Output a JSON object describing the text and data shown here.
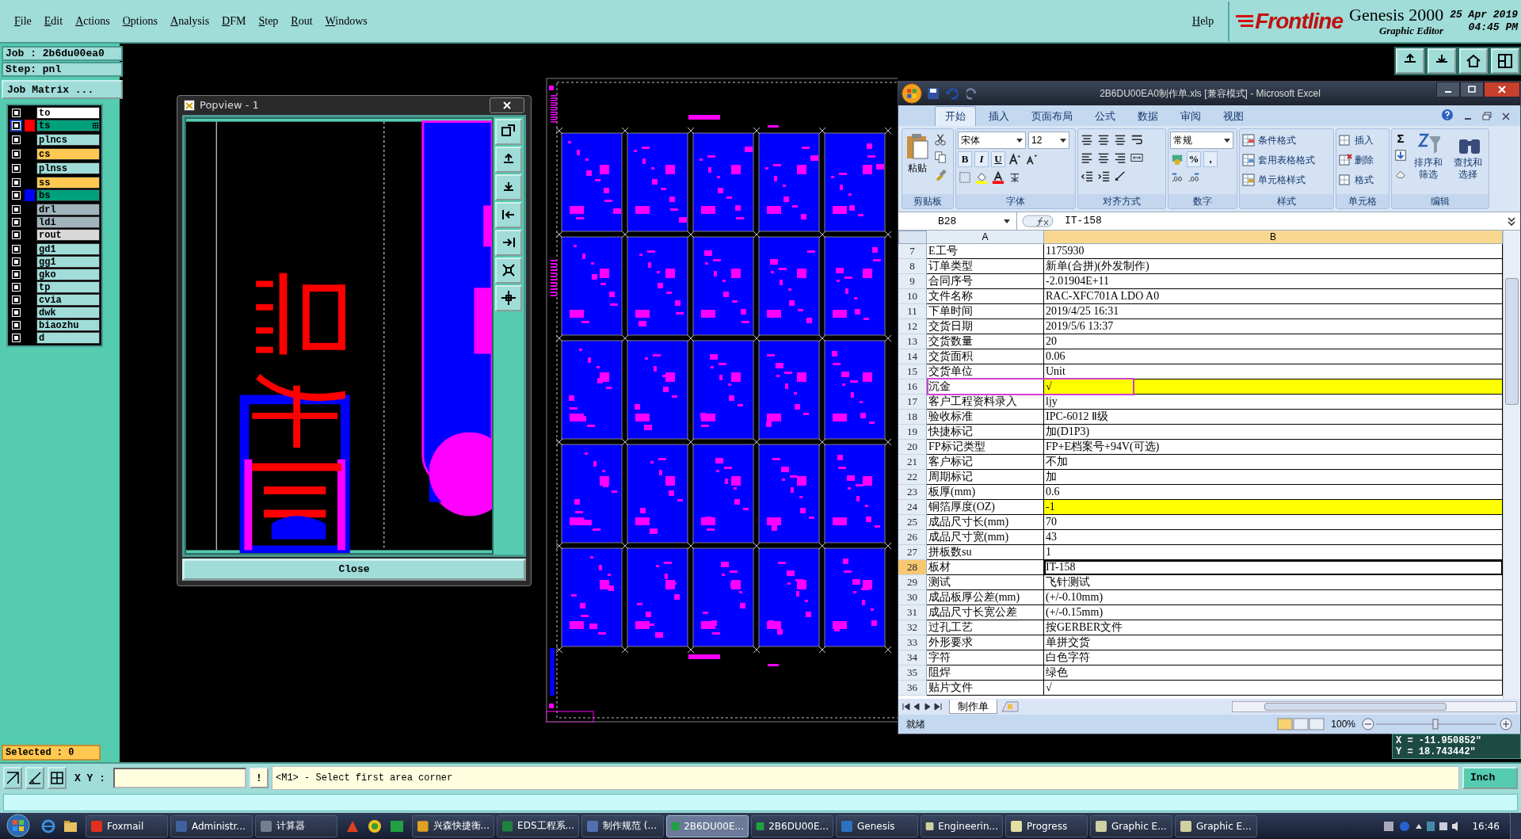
{
  "menu_bar": {
    "items": [
      "File",
      "Edit",
      "Actions",
      "Options",
      "Analysis",
      "DFM",
      "Step",
      "Rout",
      "Windows"
    ],
    "help": "Help"
  },
  "brand": {
    "logo": "Frontline",
    "product": "Genesis 2000",
    "subtitle": "Graphic Editor",
    "date": "25 Apr 2019",
    "time": "04:45 PM"
  },
  "job_panel": {
    "job": "Job : 2b6du00ea0",
    "step": "Step: pnl",
    "matrix_button": "Job Matrix ...",
    "layer_groups": [
      [
        {
          "name": "to",
          "color": "#ffffff",
          "affected": false,
          "linked": false
        },
        {
          "name": "ts",
          "color": "#00a07c",
          "affected": true,
          "linked": true,
          "swatch": {
            "color": "#ff0000"
          }
        }
      ],
      [
        {
          "name": "plncs",
          "color": "#a0dcd8",
          "affected": false,
          "linked": false
        }
      ],
      [
        {
          "name": "cs",
          "color": "#ffc850",
          "affected": false,
          "linked": false
        }
      ],
      [
        {
          "name": "plnss",
          "color": "#a0dcd8",
          "affected": false,
          "linked": false
        }
      ],
      [
        {
          "name": "ss",
          "color": "#ffc850",
          "affected": false,
          "linked": false
        },
        {
          "name": "bs",
          "color": "#00a07c",
          "affected": false,
          "linked": false,
          "swatch": {
            "color": "#0000ff"
          }
        }
      ],
      [
        {
          "name": "drl",
          "color": "#a0b4bc",
          "affected": false,
          "linked": false
        },
        {
          "name": "ldi",
          "color": "#a0b4bc",
          "affected": false,
          "linked": false
        },
        {
          "name": "rout",
          "color": "#d8d8d8",
          "affected": false,
          "linked": false
        }
      ],
      [
        {
          "name": "gd1",
          "color": "#a0dcd8",
          "affected": false,
          "linked": false
        },
        {
          "name": "gg1",
          "color": "#a0dcd8",
          "affected": false,
          "linked": false
        },
        {
          "name": "gko",
          "color": "#a0dcd8",
          "affected": false,
          "linked": false
        },
        {
          "name": "tp",
          "color": "#a0dcd8",
          "affected": false,
          "linked": false
        },
        {
          "name": "cvia",
          "color": "#a0dcd8",
          "affected": false,
          "linked": false
        },
        {
          "name": "dwk",
          "color": "#a0dcd8",
          "affected": false,
          "linked": false
        },
        {
          "name": "biaozhu",
          "color": "#a0dcd8",
          "affected": false,
          "linked": false
        },
        {
          "name": "d",
          "color": "#a0dcd8",
          "affected": false,
          "linked": false
        }
      ]
    ],
    "selected": "Selected : 0"
  },
  "popview": {
    "title": "Popview - 1",
    "close_button": "Close"
  },
  "excel": {
    "title": "2B6DU00EA0制作单.xls  [兼容模式] - Microsoft Excel",
    "tabs": [
      {
        "label": "开始",
        "selected": true
      },
      {
        "label": "插入",
        "selected": false
      },
      {
        "label": "页面布局",
        "selected": false
      },
      {
        "label": "公式",
        "selected": false
      },
      {
        "label": "数据",
        "selected": false
      },
      {
        "label": "审阅",
        "selected": false
      },
      {
        "label": "视图",
        "selected": false
      }
    ],
    "ribbon": {
      "clipboard": {
        "paste": "粘贴",
        "label": "剪贴板"
      },
      "font": {
        "name": "宋体",
        "size": "12",
        "bold": "B",
        "italic": "I",
        "underline": "U",
        "label": "字体"
      },
      "alignment": {
        "label": "对齐方式"
      },
      "number": {
        "format": "常规",
        "percent": "%",
        "comma": ",",
        "label": "数字"
      },
      "styles": {
        "items": [
          "条件格式",
          "套用表格格式",
          "单元格样式"
        ],
        "label": "样式"
      },
      "cells": {
        "items": [
          "插入",
          "删除",
          "格式"
        ],
        "label": "单元格"
      },
      "editing": {
        "sum": "Σ",
        "sort": "排序和筛选",
        "find": "查找和选择",
        "label": "编辑"
      }
    },
    "name_box": "B28",
    "formula": "IT-158",
    "columns": [
      "A",
      "B"
    ],
    "rows": [
      {
        "number": "7",
        "a": "E工号",
        "b": "1175930",
        "selected": false,
        "highlight": false,
        "annotated": false
      },
      {
        "number": "8",
        "a": "订单类型",
        "b": "新单(合拼)(外发制作)",
        "selected": false,
        "highlight": false,
        "annotated": false
      },
      {
        "number": "9",
        "a": "合同序号",
        "b": "-2.01904E+11",
        "selected": false,
        "highlight": false,
        "annotated": false
      },
      {
        "number": "10",
        "a": "文件名称",
        "b": "RAC-XFC701A LDO A0",
        "selected": false,
        "highlight": false,
        "annotated": false
      },
      {
        "number": "11",
        "a": "下单时间",
        "b": "2019/4/25 16:31",
        "selected": false,
        "highlight": false,
        "annotated": false
      },
      {
        "number": "12",
        "a": "交货日期",
        "b": "2019/5/6 13:37",
        "selected": false,
        "highlight": false,
        "annotated": false
      },
      {
        "number": "13",
        "a": "交货数量",
        "b": "20",
        "selected": false,
        "highlight": false,
        "annotated": false
      },
      {
        "number": "14",
        "a": "交货面积",
        "b": "0.06",
        "selected": false,
        "highlight": false,
        "annotated": false
      },
      {
        "number": "15",
        "a": "交货单位",
        "b": "Unit",
        "selected": false,
        "highlight": false,
        "annotated": false
      },
      {
        "number": "16",
        "a": "沉金",
        "b": "√",
        "selected": false,
        "highlight": true,
        "annotated": true
      },
      {
        "number": "17",
        "a": "客户工程资料录入",
        "b": "ljy",
        "selected": false,
        "highlight": false,
        "annotated": false
      },
      {
        "number": "18",
        "a": "验收标准",
        "b": "IPC-6012 Ⅱ级",
        "selected": false,
        "highlight": false,
        "annotated": false
      },
      {
        "number": "19",
        "a": "快捷标记",
        "b": "加(D1P3)",
        "selected": false,
        "highlight": false,
        "annotated": false
      },
      {
        "number": "20",
        "a": "FP标记类型",
        "b": "FP+E档案号+94V(可选)",
        "selected": false,
        "highlight": false,
        "annotated": false
      },
      {
        "number": "21",
        "a": "客户标记",
        "b": "不加",
        "selected": false,
        "highlight": false,
        "annotated": false
      },
      {
        "number": "22",
        "a": "周期标记",
        "b": "加",
        "selected": false,
        "highlight": false,
        "annotated": false
      },
      {
        "number": "23",
        "a": "板厚(mm)",
        "b": "0.6",
        "selected": false,
        "highlight": false,
        "annotated": false
      },
      {
        "number": "24",
        "a": "铜箔厚度(OZ)",
        "b": "-1",
        "selected": false,
        "highlight": true,
        "annotated": false
      },
      {
        "number": "25",
        "a": "成品尺寸长(mm)",
        "b": "70",
        "selected": false,
        "highlight": false,
        "annotated": false
      },
      {
        "number": "26",
        "a": "成品尺寸宽(mm)",
        "b": "43",
        "selected": false,
        "highlight": false,
        "annotated": false
      },
      {
        "number": "27",
        "a": "拼板数su",
        "b": "1",
        "selected": false,
        "highlight": false,
        "annotated": false
      },
      {
        "number": "28",
        "a": "板材",
        "b": "IT-158",
        "selected": true,
        "highlight": false,
        "annotated": false
      },
      {
        "number": "29",
        "a": "测试",
        "b": "飞针测试",
        "selected": false,
        "highlight": false,
        "annotated": false
      },
      {
        "number": "30",
        "a": "成品板厚公差(mm)",
        "b": "(+/-0.10mm)",
        "selected": false,
        "highlight": false,
        "annotated": false
      },
      {
        "number": "31",
        "a": "成品尺寸长宽公差",
        "b": "(+/-0.15mm)",
        "selected": false,
        "highlight": false,
        "annotated": false
      },
      {
        "number": "32",
        "a": "过孔工艺",
        "b": "按GERBER文件",
        "selected": false,
        "highlight": false,
        "annotated": false
      },
      {
        "number": "33",
        "a": "外形要求",
        "b": "单拼交货",
        "selected": false,
        "highlight": false,
        "annotated": false
      },
      {
        "number": "34",
        "a": "字符",
        "b": "白色字符",
        "selected": false,
        "highlight": false,
        "annotated": false
      },
      {
        "number": "35",
        "a": "阻焊",
        "b": "绿色",
        "selected": false,
        "highlight": false,
        "annotated": false
      },
      {
        "number": "36",
        "a": "贴片文件",
        "b": "√",
        "selected": false,
        "highlight": false,
        "annotated": false
      }
    ],
    "sheet_tab": "制作单",
    "status": "就绪",
    "zoom": "100%"
  },
  "coordinates": [
    "X = -11.950852\"",
    "Y = 18.743442\""
  ],
  "command_bar": {
    "xy_label": "X Y :",
    "alert_button": "!",
    "prompt": "<M1> - Select first area corner",
    "units": "Inch"
  },
  "taskbar": {
    "items": [
      {
        "label": "Foxmail",
        "selected": false
      },
      {
        "label": "Administr...",
        "selected": false
      },
      {
        "label": "计算器",
        "selected": false
      },
      {
        "label": "兴森快捷衡...",
        "selected": false
      },
      {
        "label": "EDS工程系...",
        "selected": false
      },
      {
        "label": "制作规范 (...",
        "selected": false
      },
      {
        "label": "2B6DU00E...",
        "selected": true
      },
      {
        "label": "2B6DU00E...",
        "selected": false
      },
      {
        "label": "Genesis",
        "selected": false
      },
      {
        "label": "Engineerin...",
        "selected": false
      },
      {
        "label": "Progress",
        "selected": false
      },
      {
        "label": "Graphic E...",
        "selected": false
      },
      {
        "label": "Graphic E...",
        "selected": false
      }
    ],
    "clock": "16:46"
  }
}
